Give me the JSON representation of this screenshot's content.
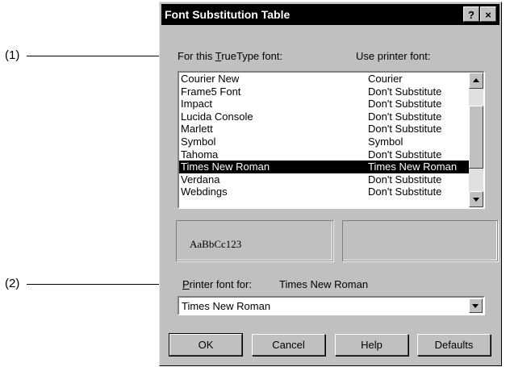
{
  "callouts": {
    "c1": "(1)",
    "c2": "(2)"
  },
  "dialog": {
    "title": "Font Substitution Table",
    "help_button": "?",
    "close_button": "×"
  },
  "labels": {
    "truetype_pre": "For this ",
    "truetype_mnemonic": "T",
    "truetype_post": "rueType font:",
    "printer_font": "Use printer font:",
    "printer_for_mnemonic": "P",
    "printer_for_post": "rinter font for:",
    "printer_for_value": "Times New Roman"
  },
  "font_list": [
    {
      "truetype": "Courier New",
      "printer": "Courier"
    },
    {
      "truetype": "Frame5 Font",
      "printer": "Don't Substitute"
    },
    {
      "truetype": "Impact",
      "printer": "Don't Substitute"
    },
    {
      "truetype": "Lucida Console",
      "printer": "Don't Substitute"
    },
    {
      "truetype": "Marlett",
      "printer": "Don't Substitute"
    },
    {
      "truetype": "Symbol",
      "printer": "Symbol"
    },
    {
      "truetype": "Tahoma",
      "printer": "Don't Substitute"
    },
    {
      "truetype": "Times New Roman",
      "printer": "Times New Roman"
    },
    {
      "truetype": "Verdana",
      "printer": "Don't Substitute"
    },
    {
      "truetype": "Webdings",
      "printer": "Don't Substitute"
    }
  ],
  "sample_text": "AaBbCc123",
  "combo_value": "Times New Roman",
  "buttons": {
    "ok": "OK",
    "cancel": "Cancel",
    "help": "Help",
    "defaults": "Defaults"
  }
}
